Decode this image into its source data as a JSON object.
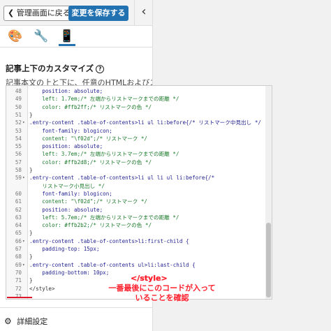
{
  "topbar": {
    "back_label": "管理画面に戻る",
    "back_icon": "chevron-left-icon",
    "save_label": "変更を保存する",
    "collapse_icon": "chevron-left-icon"
  },
  "tabs": [
    {
      "icon": "palette-icon",
      "glyph": "🎨"
    },
    {
      "icon": "wrench-icon",
      "glyph": "🔧"
    },
    {
      "icon": "mobile-icon",
      "glyph": "📱"
    }
  ],
  "section": {
    "title": "記事上下のカスタマイズ",
    "help_glyph": "?",
    "desc": "記事本文の上と下に、任意のHTMLおよびスク"
  },
  "editor": {
    "lines": [
      {
        "n": "48",
        "fold": "",
        "text": "    position: absolute;"
      },
      {
        "n": "49",
        "fold": "",
        "text": "    left: 1.7em;/* 左端からリストマークまでの距離 */"
      },
      {
        "n": "50",
        "fold": "",
        "text": "    color: #ffb2ff;/* リストマークの色 */"
      },
      {
        "n": "51",
        "fold": "",
        "text": "}"
      },
      {
        "n": "52",
        "fold": "▾",
        "text": ".entry-content .table-of-contents>li ul li:before{/* リストマーク中見出し */"
      },
      {
        "n": "53",
        "fold": "",
        "text": "    font-family: blogicon;"
      },
      {
        "n": "54",
        "fold": "",
        "text": "    content: \"\\f02d\";/* リストマーク */"
      },
      {
        "n": "55",
        "fold": "",
        "text": "    position: absolute;"
      },
      {
        "n": "56",
        "fold": "",
        "text": "    left: 3.7em;/* 左端からリストマークまでの距離 */"
      },
      {
        "n": "57",
        "fold": "",
        "text": "    color: #ffb2d8;/* リストマークの色 */"
      },
      {
        "n": "58",
        "fold": "",
        "text": "}"
      },
      {
        "n": "59",
        "fold": "▾",
        "text": ".entry-content .table-of-contents>li ul li ul li:before{/*"
      },
      {
        "n": "",
        "fold": "",
        "text": "    リストマーク小見出し */"
      },
      {
        "n": "60",
        "fold": "",
        "text": "    font-family: blogicon;"
      },
      {
        "n": "61",
        "fold": "",
        "text": "    content: \"\\f02d\";/* リストマーク */"
      },
      {
        "n": "62",
        "fold": "",
        "text": "    position: absolute;"
      },
      {
        "n": "63",
        "fold": "",
        "text": "    left: 5.7em;/* 左端からリストマークまでの距離 */"
      },
      {
        "n": "64",
        "fold": "",
        "text": "    color: #ffb2b2;/* リストマークの色 */"
      },
      {
        "n": "65",
        "fold": "",
        "text": "}"
      },
      {
        "n": "66",
        "fold": "▾",
        "text": ".entry-content .table-of-contents>li:first-child {"
      },
      {
        "n": "67",
        "fold": "",
        "text": "    padding-top: 15px;"
      },
      {
        "n": "68",
        "fold": "",
        "text": "}"
      },
      {
        "n": "69",
        "fold": "▾",
        "text": ".entry-content .table-of-contents ul>li:last-child {"
      },
      {
        "n": "70",
        "fold": "",
        "text": "    padding-bottom: 10px;"
      },
      {
        "n": "71",
        "fold": "",
        "text": "}"
      },
      {
        "n": "72",
        "fold": "",
        "text": "</style>"
      },
      {
        "n": "73",
        "fold": "",
        "text": ""
      }
    ]
  },
  "annotation": {
    "style_tag": "</style>",
    "text": "一番最後にこのコードが入っていることを確認",
    "color": "#ff1f2d"
  },
  "footer": {
    "label": "詳細設定",
    "icon": "gear-icon"
  },
  "colors": {
    "accent": "#2271b1"
  }
}
